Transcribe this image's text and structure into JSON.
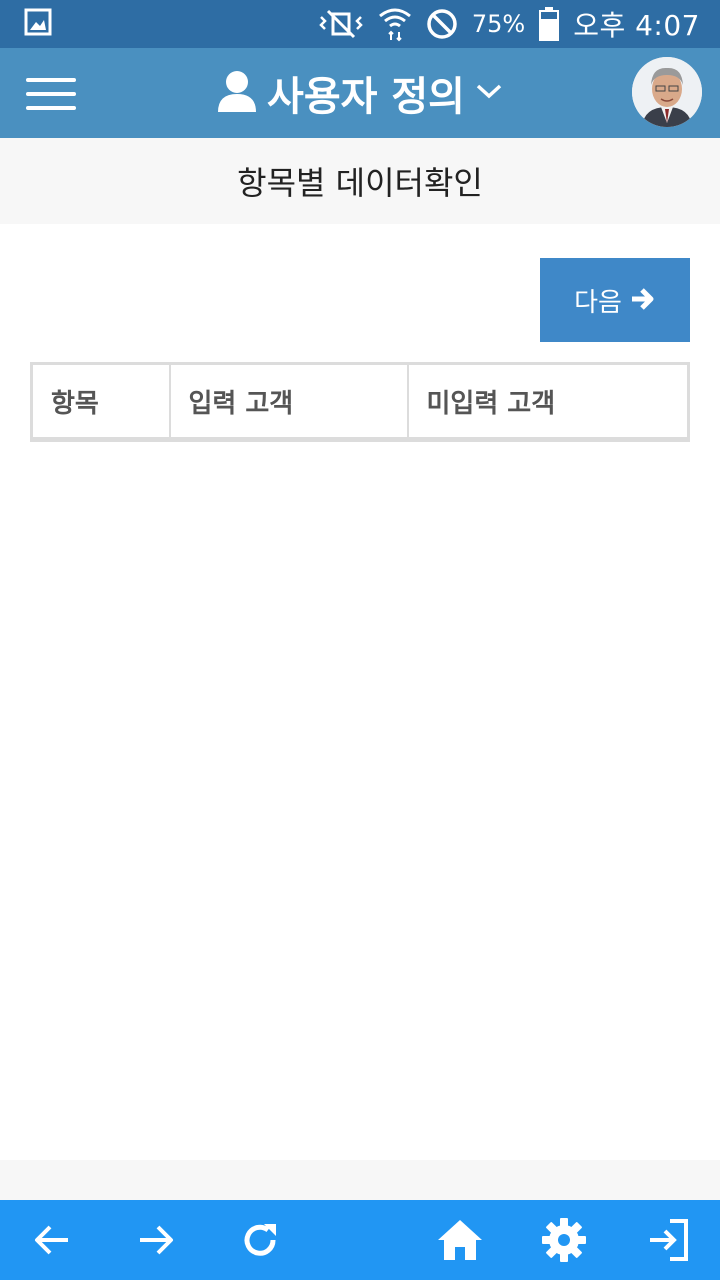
{
  "status_bar": {
    "battery_percent": "75%",
    "time": "오후 4:07",
    "icons": [
      "gallery-icon",
      "vibrate-mute-icon",
      "wifi-icon",
      "do-not-disturb-icon",
      "battery-icon"
    ]
  },
  "header": {
    "title": "사용자 정의",
    "icons": [
      "menu-icon",
      "user-icon",
      "chevron-down-icon"
    ],
    "avatar": "profile-photo"
  },
  "page": {
    "title": "항목별 데이터확인"
  },
  "actions": {
    "next_label": "다음",
    "next_icon": "arrow-right-icon"
  },
  "table": {
    "columns": [
      "항목",
      "입력 고객",
      "미입력 고객"
    ],
    "rows": []
  },
  "bottom_nav": {
    "items": [
      "back-icon",
      "forward-icon",
      "refresh-icon",
      "home-icon",
      "settings-icon",
      "logout-icon"
    ]
  },
  "colors": {
    "status_bar": "#2e6da4",
    "header": "#4a90c0",
    "button": "#3f88c8",
    "bottom_nav": "#2196f3"
  }
}
